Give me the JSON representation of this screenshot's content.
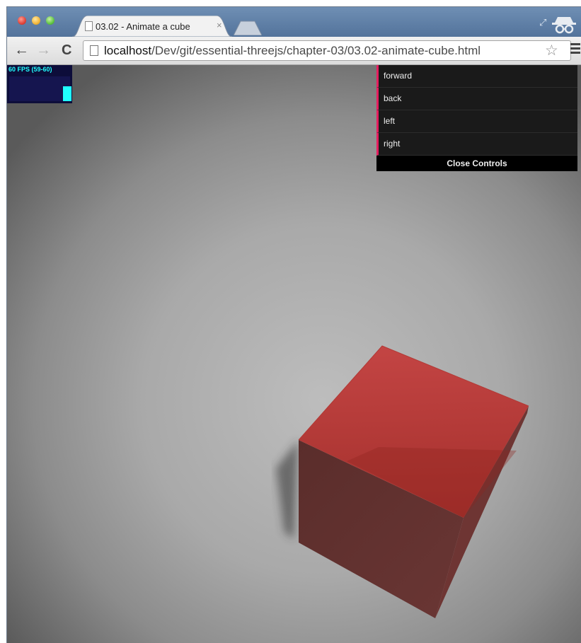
{
  "browser": {
    "tab_title": "03.02 - Animate a cube",
    "tab_close": "×",
    "url_host": "localhost",
    "url_path": "/Dev/git/essential-threejs/chapter-03/03.02-animate-cube.html"
  },
  "stats": {
    "label": "60 FPS (59-60)"
  },
  "gui": {
    "items": [
      {
        "label": "forward"
      },
      {
        "label": "back"
      },
      {
        "label": "left"
      },
      {
        "label": "right"
      }
    ],
    "close_label": "Close Controls",
    "accent_color": "#e61d5f"
  },
  "scene": {
    "cube_color": "#c0403f"
  }
}
